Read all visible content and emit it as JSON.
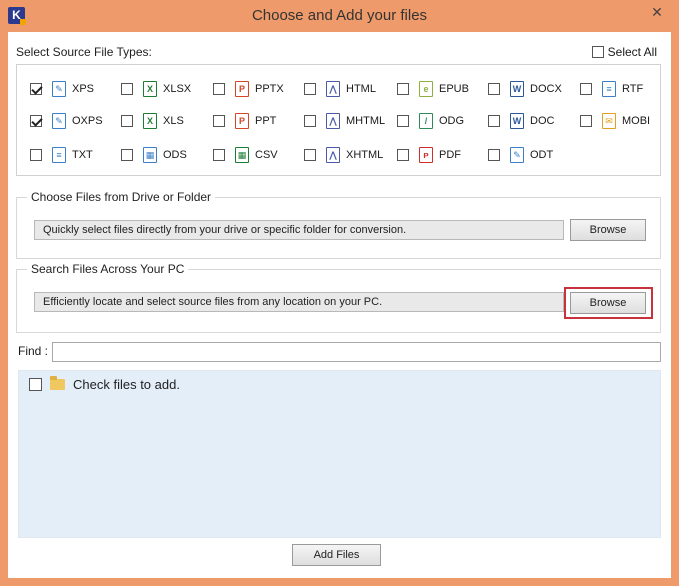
{
  "window": {
    "title": "Choose and Add your files",
    "app_icon_letter": "K",
    "close_glyph": "✕"
  },
  "file_types": {
    "section_label": "Select Source File Types:",
    "select_all_label": "Select All",
    "select_all_checked": false,
    "items": [
      {
        "label": "XPS",
        "checked": true,
        "icon": "xps-file-icon",
        "color": "#3a7fc8",
        "glyph": "✎"
      },
      {
        "label": "XLSX",
        "checked": false,
        "icon": "xlsx-file-icon",
        "color": "#1e7d34",
        "glyph": "X"
      },
      {
        "label": "PPTX",
        "checked": false,
        "icon": "pptx-file-icon",
        "color": "#d24726",
        "glyph": "P"
      },
      {
        "label": "HTML",
        "checked": false,
        "icon": "html-file-icon",
        "color": "#4a5aa8",
        "glyph": "⋀"
      },
      {
        "label": "EPUB",
        "checked": false,
        "icon": "epub-file-icon",
        "color": "#8cb043",
        "glyph": "e"
      },
      {
        "label": "DOCX",
        "checked": false,
        "icon": "docx-file-icon",
        "color": "#2b579a",
        "glyph": "W"
      },
      {
        "label": "RTF",
        "checked": false,
        "icon": "rtf-file-icon",
        "color": "#3a7fc8",
        "glyph": "≡"
      },
      {
        "label": "OXPS",
        "checked": true,
        "icon": "oxps-file-icon",
        "color": "#3a7fc8",
        "glyph": "✎"
      },
      {
        "label": "XLS",
        "checked": false,
        "icon": "xls-file-icon",
        "color": "#1e7d34",
        "glyph": "X"
      },
      {
        "label": "PPT",
        "checked": false,
        "icon": "ppt-file-icon",
        "color": "#d24726",
        "glyph": "P"
      },
      {
        "label": "MHTML",
        "checked": false,
        "icon": "mhtml-file-icon",
        "color": "#4a5aa8",
        "glyph": "⋀"
      },
      {
        "label": "ODG",
        "checked": false,
        "icon": "odg-file-icon",
        "color": "#2e8b57",
        "glyph": "/"
      },
      {
        "label": "DOC",
        "checked": false,
        "icon": "doc-file-icon",
        "color": "#2b579a",
        "glyph": "W"
      },
      {
        "label": "MOBI",
        "checked": false,
        "icon": "mobi-file-icon",
        "color": "#e0a020",
        "glyph": "✉"
      },
      {
        "label": "TXT",
        "checked": false,
        "icon": "txt-file-icon",
        "color": "#3a7fc8",
        "glyph": "≡"
      },
      {
        "label": "ODS",
        "checked": false,
        "icon": "ods-file-icon",
        "color": "#3a7fc8",
        "glyph": "▦"
      },
      {
        "label": "CSV",
        "checked": false,
        "icon": "csv-file-icon",
        "color": "#1e7d34",
        "glyph": "▦"
      },
      {
        "label": "XHTML",
        "checked": false,
        "icon": "xhtml-file-icon",
        "color": "#4a5aa8",
        "glyph": "⋀"
      },
      {
        "label": "PDF",
        "checked": false,
        "icon": "pdf-file-icon",
        "color": "#d0302a",
        "glyph": "ᴘ"
      },
      {
        "label": "ODT",
        "checked": false,
        "icon": "odt-file-icon",
        "color": "#3a7fc8",
        "glyph": "✎"
      }
    ]
  },
  "drive_section": {
    "title": "Choose Files from Drive or Folder",
    "info": "Quickly select files directly from your drive or specific folder for conversion.",
    "button_label": "Browse"
  },
  "search_section": {
    "title": "Search Files Across Your PC",
    "info": "Efficiently locate and select source files from any location on your PC.",
    "button_label": "Browse"
  },
  "find": {
    "label": "Find :",
    "value": "",
    "placeholder": ""
  },
  "file_tree": {
    "root_label": "Check files to add.",
    "root_checked": false
  },
  "footer": {
    "add_files_label": "Add Files"
  },
  "colors": {
    "title_bar": "#ef9a6a",
    "highlight": "#c8323c",
    "tree_background": "#e4eef9"
  }
}
